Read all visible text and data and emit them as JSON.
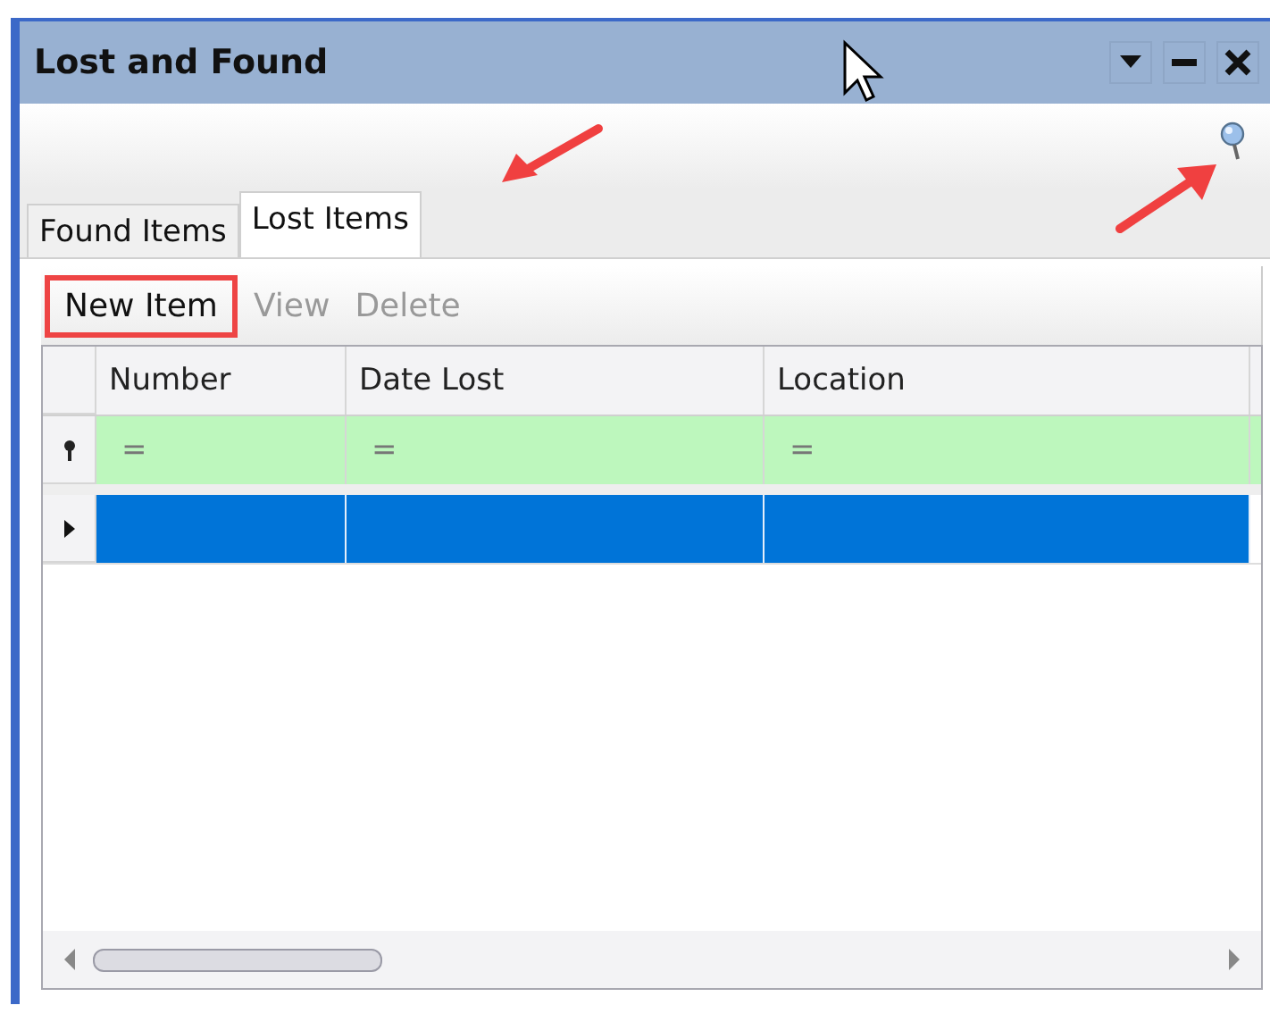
{
  "window": {
    "title": "Lost and Found"
  },
  "tabs": [
    {
      "label": "Found Items",
      "selected": false
    },
    {
      "label": "Lost Items",
      "selected": true
    }
  ],
  "toolbar": [
    {
      "label": "New Item",
      "disabled": false,
      "highlighted": true
    },
    {
      "label": "View",
      "disabled": true,
      "highlighted": false
    },
    {
      "label": "Delete",
      "disabled": true,
      "highlighted": false
    }
  ],
  "table": {
    "columns": [
      "Number",
      "Date Lost",
      "Location"
    ],
    "filter_row": [
      "=",
      "=",
      "="
    ],
    "rows": [
      {
        "selected": true,
        "cells": [
          "",
          "",
          ""
        ]
      }
    ]
  }
}
